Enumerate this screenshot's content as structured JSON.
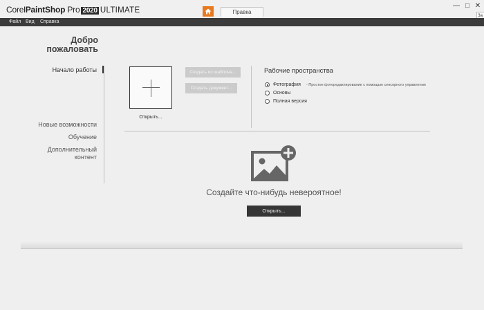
{
  "app": {
    "brand_corel": "Corel",
    "brand_paintshop": "PaintShop",
    "brand_pro": "Pro",
    "brand_year": "2020",
    "brand_edition": "ULTIMATE"
  },
  "tabs": {
    "edit_label": "Правка"
  },
  "window_controls": {
    "minimize": "—",
    "maximize": "□",
    "close": "✕",
    "side_tag": "За"
  },
  "menu": {
    "items": [
      "Файл",
      "Вид",
      "Справка"
    ]
  },
  "welcome": {
    "line1": "Добро",
    "line2": "пожаловать"
  },
  "nav": {
    "getting_started": "Начало работы",
    "whats_new": "Новые возможности",
    "learning": "Обучение",
    "additional_line1": "Дополнительный",
    "additional_line2": "контент"
  },
  "start": {
    "open_label": "Открыть...",
    "from_template": "Создать из шаблона...",
    "create_document": "Создать документ..."
  },
  "workspaces": {
    "title": "Рабочие пространства",
    "options": [
      {
        "label": "Фотография",
        "desc": "- Простое фоторедактирование с помощью сенсорного управления",
        "selected": true
      },
      {
        "label": "Основы",
        "desc": "",
        "selected": false
      },
      {
        "label": "Полная версия",
        "desc": "",
        "selected": false
      }
    ]
  },
  "create": {
    "headline": "Создайте что-нибудь невероятное!",
    "open_button": "Открыть..."
  },
  "icons": {
    "home": "home-icon",
    "plus": "plus-icon",
    "add_image": "add-image-icon"
  },
  "colors": {
    "accent": "#e8791f",
    "menubar": "#3b3b3b",
    "dark_button": "#353535",
    "disabled_button": "#cbcbcb"
  }
}
